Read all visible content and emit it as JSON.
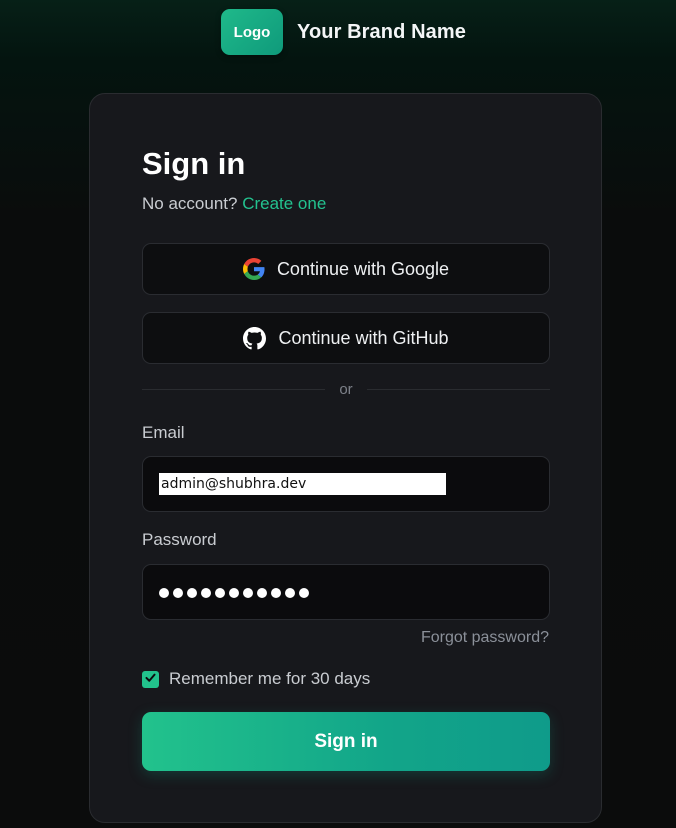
{
  "header": {
    "logo_text": "Logo",
    "brand_name": "Your Brand Name"
  },
  "signin": {
    "title": "Sign in",
    "no_account_text": "No account?",
    "create_link": "Create one",
    "google_label": "Continue with Google",
    "github_label": "Continue with GitHub",
    "divider_text": "or",
    "email_label": "Email",
    "email_value": "admin@shubhra.dev",
    "password_label": "Password",
    "password_mask": "●●●●●●●●●●●",
    "forgot_label": "Forgot password?",
    "remember_label": "Remember me for 30 days",
    "remember_checked": true,
    "submit_label": "Sign in"
  },
  "icons": {
    "google": "google-icon",
    "github": "github-icon",
    "checkbox": "check-icon"
  },
  "colors": {
    "accent": "#22c28c",
    "accent_dark": "#0f9b8a",
    "card_bg": "#17181c",
    "page_bg": "#0b0c0c"
  }
}
